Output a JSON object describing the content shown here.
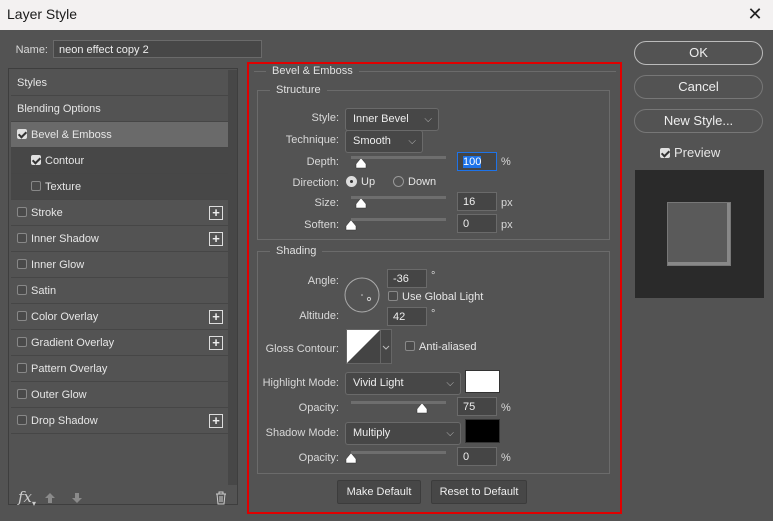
{
  "window": {
    "title": "Layer Style",
    "close_icon": "close-icon"
  },
  "name_field": {
    "label": "Name:",
    "value": "neon effect copy 2"
  },
  "styles_list": [
    {
      "label": "Styles",
      "type": "header"
    },
    {
      "label": "Blending Options",
      "type": "header"
    },
    {
      "label": "Bevel & Emboss",
      "checked": true,
      "selected": true
    },
    {
      "label": "Contour",
      "checked": true,
      "sub": true
    },
    {
      "label": "Texture",
      "checked": false,
      "sub": true
    },
    {
      "label": "Stroke",
      "checked": false,
      "plus": true
    },
    {
      "label": "Inner Shadow",
      "checked": false,
      "plus": true
    },
    {
      "label": "Inner Glow",
      "checked": false
    },
    {
      "label": "Satin",
      "checked": false
    },
    {
      "label": "Color Overlay",
      "checked": false,
      "plus": true
    },
    {
      "label": "Gradient Overlay",
      "checked": false,
      "plus": true
    },
    {
      "label": "Pattern Overlay",
      "checked": false
    },
    {
      "label": "Outer Glow",
      "checked": false
    },
    {
      "label": "Drop Shadow",
      "checked": false,
      "plus": true
    }
  ],
  "list_footer": {
    "fx_label": "fx",
    "icons": [
      "fx-icon",
      "move-up-icon",
      "move-down-icon",
      "trash-icon"
    ]
  },
  "panel": {
    "title": "Bevel & Emboss",
    "highlight_border_color": "#e00000",
    "structure": {
      "title": "Structure",
      "style_label": "Style:",
      "style_value": "Inner Bevel",
      "technique_label": "Technique:",
      "technique_value": "Smooth",
      "depth_label": "Depth:",
      "depth_value": "100",
      "depth_unit": "%",
      "depth_slider": 0.1,
      "direction_label": "Direction:",
      "direction_up": "Up",
      "direction_down": "Down",
      "direction_selected": "Up",
      "size_label": "Size:",
      "size_value": "16",
      "size_unit": "px",
      "size_slider": 0.1,
      "soften_label": "Soften:",
      "soften_value": "0",
      "soften_unit": "px",
      "soften_slider": 0
    },
    "shading": {
      "title": "Shading",
      "angle_label": "Angle:",
      "angle_value": "-36",
      "degree": "°",
      "global_light_label": "Use Global Light",
      "global_light_checked": false,
      "altitude_label": "Altitude:",
      "altitude_value": "42",
      "gloss_label": "Gloss Contour:",
      "anti_aliased_label": "Anti-aliased",
      "anti_aliased_checked": false,
      "highlight_label": "Highlight Mode:",
      "highlight_value": "Vivid Light",
      "highlight_color": "#ffffff",
      "highlight_opacity_label": "Opacity:",
      "highlight_opacity": "75",
      "highlight_opacity_slider": 0.75,
      "percent": "%",
      "shadow_label": "Shadow Mode:",
      "shadow_value": "Multiply",
      "shadow_color": "#000000",
      "shadow_opacity_label": "Opacity:",
      "shadow_opacity": "0",
      "shadow_opacity_slider": 0
    },
    "make_default": "Make Default",
    "reset_default": "Reset to Default"
  },
  "actions": {
    "ok": "OK",
    "cancel": "Cancel",
    "new_style": "New Style...",
    "preview_label": "Preview",
    "preview_checked": true
  }
}
